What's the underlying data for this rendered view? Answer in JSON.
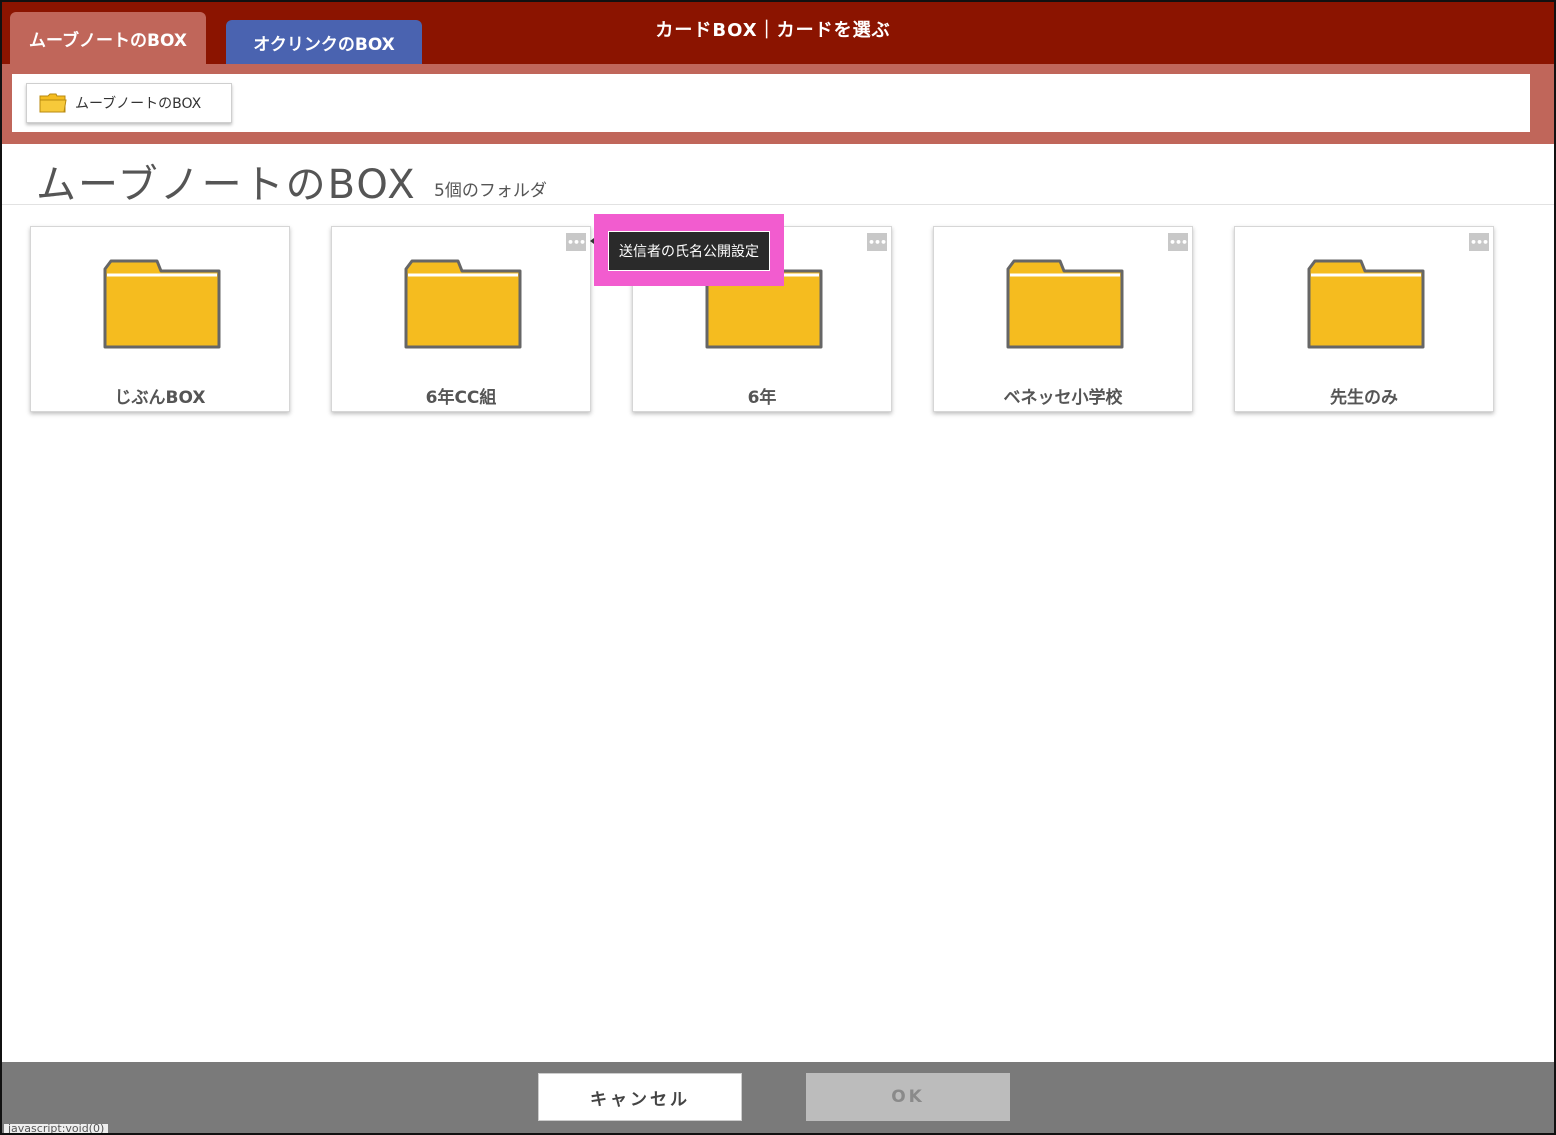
{
  "window": {
    "title": "カードBOX｜カードを選ぶ"
  },
  "tabs": [
    {
      "label": "ムーブノートのBOX",
      "active": true
    },
    {
      "label": "オクリンクのBOX",
      "active": false
    }
  ],
  "breadcrumb": {
    "label": "ムーブノートのBOX"
  },
  "main": {
    "title": "ムーブノートのBOX",
    "folder_count": "5個のフォルダ"
  },
  "folders": [
    {
      "label": "じぶんBOX",
      "has_menu": false
    },
    {
      "label": "6年CC組",
      "has_menu": true
    },
    {
      "label": "6年",
      "has_menu": true
    },
    {
      "label": "ベネッセ小学校",
      "has_menu": true
    },
    {
      "label": "先生のみ",
      "has_menu": true
    }
  ],
  "menu_icon": "•••",
  "tooltip": {
    "text": "送信者の氏名公開設定"
  },
  "footer": {
    "cancel_label": "キャンセル",
    "ok_label": "OK"
  },
  "status_bar": {
    "text": "javascript:void(0)"
  },
  "colors": {
    "header_bg": "#8b1400",
    "tab_active": "#c0665a",
    "tab_other": "#4a63b0",
    "folder_yellow": "#f5bc1f",
    "highlight": "#f25ccf",
    "footer_bg": "#7a7a7a"
  }
}
